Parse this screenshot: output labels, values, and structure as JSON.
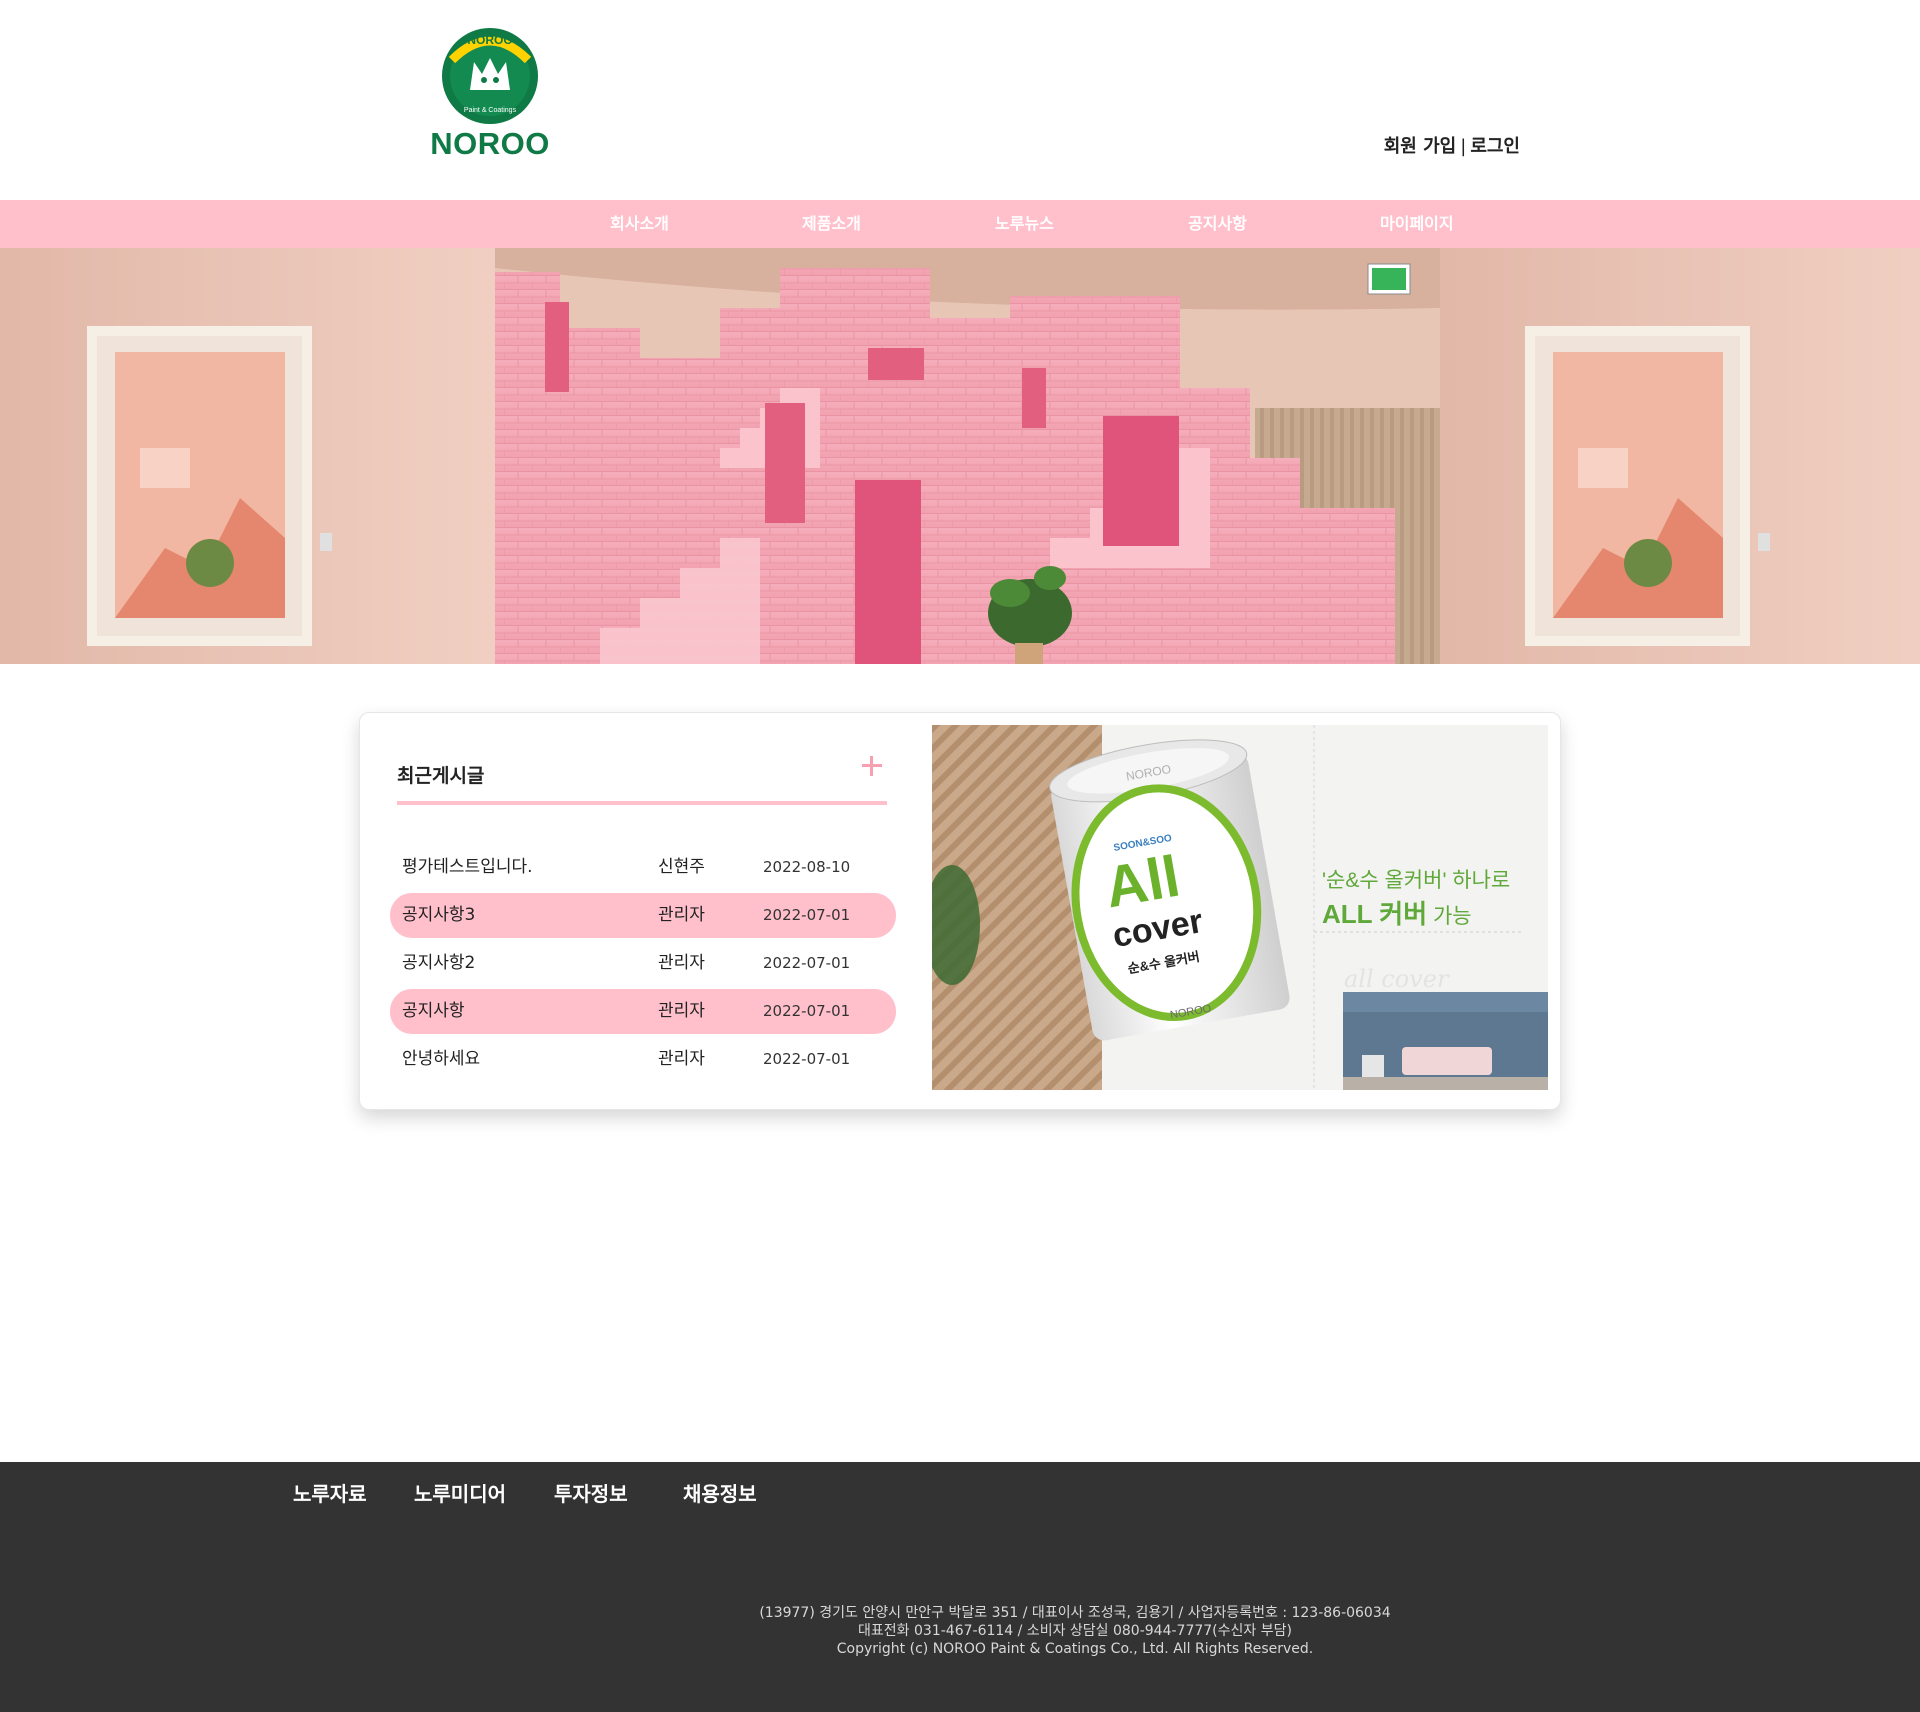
{
  "header": {
    "logo_badge_text": "NOROO",
    "logo_badge_subtext": "Paint & Coatings",
    "logo_word": "NOROO",
    "signup": "회원 가입",
    "separator": "|",
    "login": "로그인"
  },
  "nav": {
    "items": [
      "회사소개",
      "제품소개",
      "노루뉴스",
      "공지사항",
      "마이페이지"
    ]
  },
  "posts": {
    "title": "최근게시글",
    "rows": [
      {
        "title": "평가테스트입니다.",
        "author": "신현주",
        "date": "2022-08-10",
        "highlighted": false
      },
      {
        "title": "공지사항3",
        "author": "관리자",
        "date": "2022-07-01",
        "highlighted": true
      },
      {
        "title": "공지사항2",
        "author": "관리자",
        "date": "2022-07-01",
        "highlighted": false
      },
      {
        "title": "공지사항",
        "author": "관리자",
        "date": "2022-07-01",
        "highlighted": true
      },
      {
        "title": "안녕하세요",
        "author": "관리자",
        "date": "2022-07-01",
        "highlighted": false
      }
    ]
  },
  "ad": {
    "can_brand": "NOROO",
    "can_small": "SOON&SOO",
    "can_big_1": "All",
    "can_big_2": "cover",
    "can_sub": "순&수 올커버",
    "can_bottom": "NOROO",
    "headline_1": "'순&수 올커버' 하나로",
    "headline_2_bold": "ALL 커버",
    "headline_2_rest": " 가능",
    "script_text": "all cover"
  },
  "footer": {
    "links": [
      "노루자료",
      "노루미디어",
      "투자정보",
      "채용정보"
    ],
    "info_lines": [
      "(13977) 경기도 안양시 만안구 박달로 351 / 대표이사 조성국, 김용기 / 사업자등록번호 : 123-86-06034",
      "대표전화 031-467-6114 / 소비자 상담실 080-944-7777(수신자 부담)",
      "Copyright (c) NOROO Paint & Coatings Co., Ltd. All Rights Reserved."
    ]
  },
  "colors": {
    "accent_pink": "#ffbfcb",
    "brand_green": "#0f7a45",
    "footer_bg": "#333333"
  },
  "icons": {
    "more": "plus-icon"
  }
}
